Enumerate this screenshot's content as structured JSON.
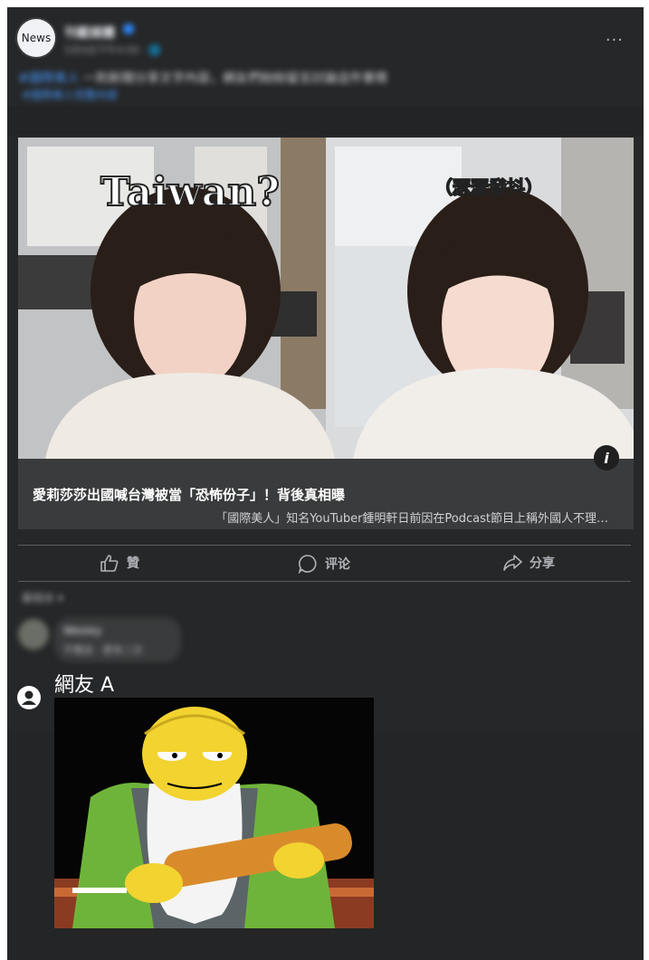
{
  "post": {
    "avatar_label": "News",
    "page_name": "刊載媒體",
    "meta": "5月4日下午4:00 · 🌐",
    "text": "一則新聞分享文字內容，網友們紛紛留言討論這件事情",
    "text_link": "#國際美人",
    "text_secondary": "#國際美人完整內容"
  },
  "card": {
    "image_overlay_left": "Taiwan?",
    "image_overlay_right": "（瑟瑟發抖）",
    "title": "愛莉莎莎出國喊台灣被當「恐怖份子」！背後真相曝",
    "subtitle": "「國際美人」知名YouTuber鍾明軒日前因在Podcast節目上稱外國人不理…"
  },
  "actions": {
    "like": "贊",
    "comment": "评论",
    "share": "分享"
  },
  "comments": {
    "sort_label": "最相关",
    "first": {
      "name": "Wesley",
      "text": "不應該 · 更有二次"
    }
  },
  "reply": {
    "username": "網友 A"
  },
  "colors": {
    "background": "#242526",
    "card": "#3a3b3c",
    "link": "#4599ff",
    "verified": "#2d88ff"
  }
}
